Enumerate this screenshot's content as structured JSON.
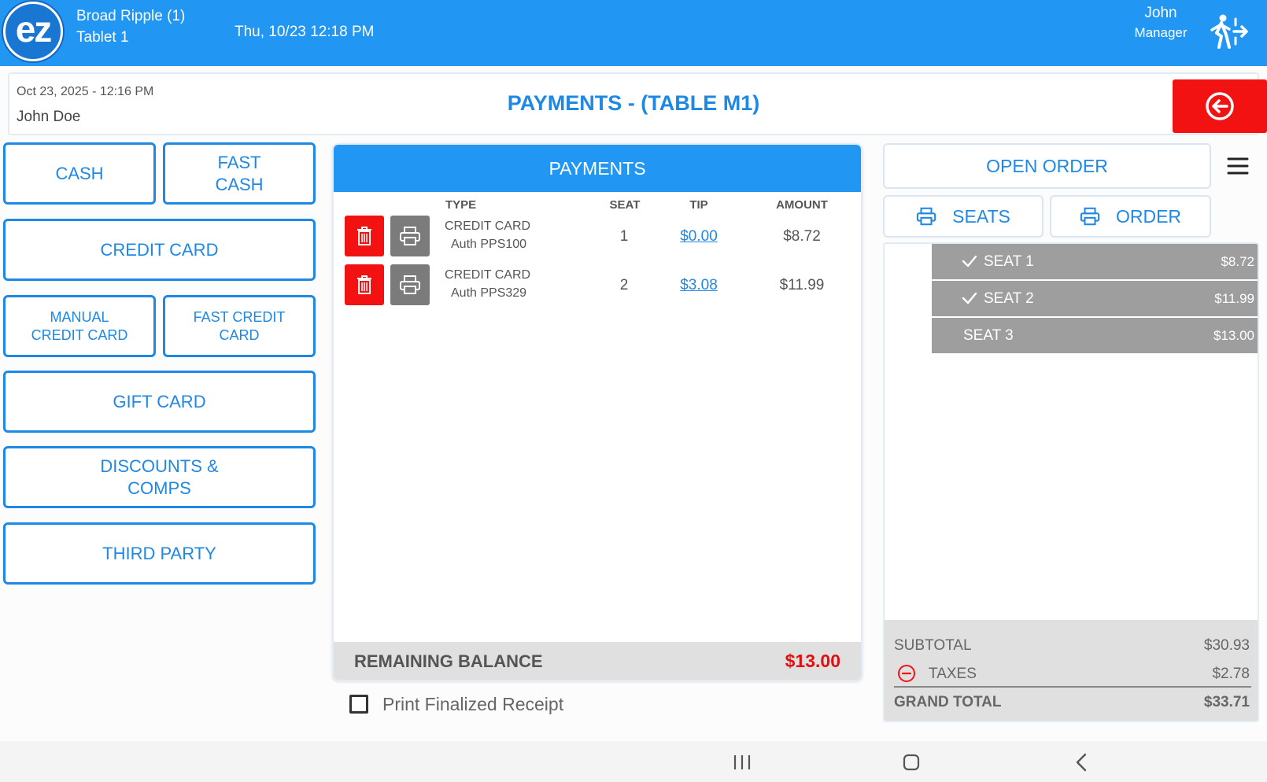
{
  "app": {
    "logo_text": "ez",
    "store": "Broad Ripple (1)",
    "device": "Tablet 1",
    "datetime": "Thu, 10/23 12:18 PM",
    "user": {
      "name": "John",
      "role": "Manager"
    }
  },
  "header": {
    "order_datetime": "Oct 23, 2025  - 12:16 PM",
    "customer": "John Doe",
    "title": "PAYMENTS - (TABLE M1)"
  },
  "payment_methods": {
    "cash": "CASH",
    "fast_cash": "FAST CASH",
    "credit_card": "CREDIT CARD",
    "manual_credit_card": "MANUAL CREDIT CARD",
    "fast_credit_card": "FAST CREDIT CARD",
    "gift_card": "GIFT CARD",
    "discounts_comps": "DISCOUNTS & COMPS",
    "third_party": "THIRD PARTY"
  },
  "payments": {
    "title": "PAYMENTS",
    "columns": {
      "type": "TYPE",
      "seat": "SEAT",
      "tip": "TIP",
      "amount": "AMOUNT"
    },
    "rows": [
      {
        "type": "CREDIT CARD",
        "auth": "Auth PPS100",
        "seat": "1",
        "tip": "$0.00",
        "amount": "$8.72"
      },
      {
        "type": "CREDIT CARD",
        "auth": "Auth PPS329",
        "seat": "2",
        "tip": "$3.08",
        "amount": "$11.99"
      }
    ],
    "remaining_label": "REMAINING BALANCE",
    "remaining_value": "$13.00"
  },
  "print_receipt": {
    "label": "Print Finalized Receipt",
    "checked": false
  },
  "right": {
    "open_order": "OPEN ORDER",
    "print_seats": "SEATS",
    "print_order": "ORDER",
    "seats": [
      {
        "label": "SEAT 1",
        "amount": "$8.72",
        "paid": true
      },
      {
        "label": "SEAT 2",
        "amount": "$11.99",
        "paid": true
      },
      {
        "label": "SEAT 3",
        "amount": "$13.00",
        "paid": false
      }
    ],
    "totals": {
      "subtotal_label": "SUBTOTAL",
      "subtotal": "$30.93",
      "taxes_label": "TAXES",
      "taxes": "$2.78",
      "grand_total_label": "GRAND TOTAL",
      "grand_total": "$33.71"
    }
  },
  "colors": {
    "primary": "#2196f3",
    "danger": "#f31212",
    "print_gray": "#7b7b7b",
    "seat_gray": "#9e9e9e"
  }
}
